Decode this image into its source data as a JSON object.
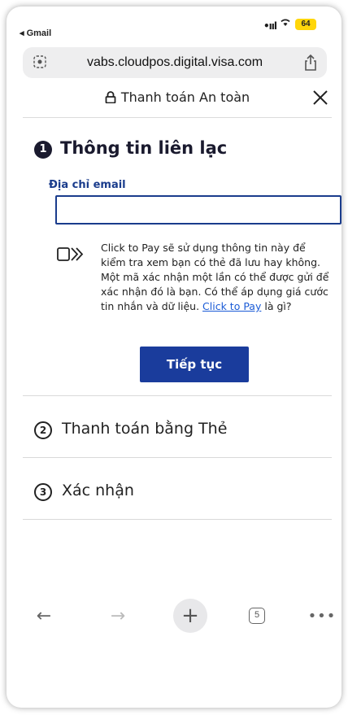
{
  "status_bar": {
    "back_app": "◂ Gmail",
    "signal": "•ııl",
    "battery": "64"
  },
  "browser": {
    "url": "vabs.cloudpos.digital.visa.com",
    "tab_count": "5"
  },
  "header": {
    "title": "Thanh toán An toàn"
  },
  "step1": {
    "number": "1",
    "title": "Thông tin liên lạc",
    "email_label": "Địa chỉ email",
    "email_value": "",
    "info_text": "Click to Pay sẽ sử dụng thông tin này để kiểm tra xem bạn có thẻ đã lưu hay không. Một mã xác nhận một lần có thể được gửi để xác nhận đó là bạn. Có thể áp dụng giá cước tin nhắn và dữ liệu. ",
    "info_link": "Click to Pay",
    "info_suffix": " là gì?",
    "continue_label": "Tiếp tục"
  },
  "step2": {
    "number": "2",
    "label": "Thanh toán bằng Thẻ"
  },
  "step3": {
    "number": "3",
    "label": "Xác nhận"
  },
  "colors": {
    "primary_button": "#1a3c9c",
    "link": "#1a5bd6",
    "battery": "#ffd60a"
  }
}
